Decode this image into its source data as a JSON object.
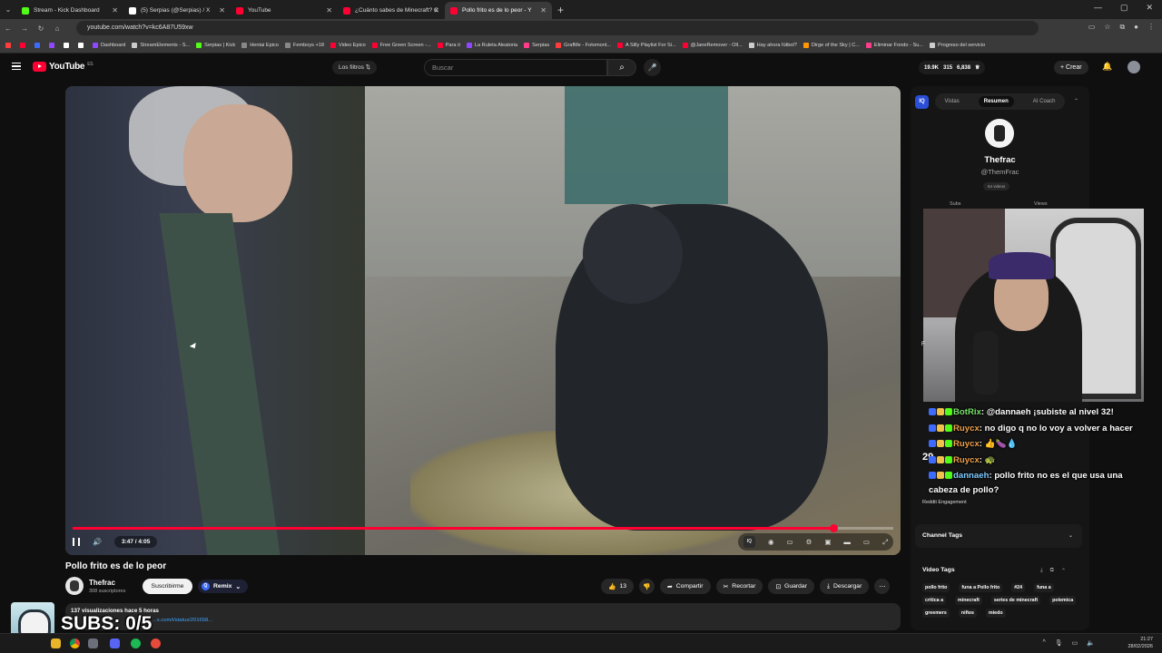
{
  "browser": {
    "tabs": [
      {
        "title": "Stream - Kick Dashboard",
        "color": "#53fc18",
        "active": false
      },
      {
        "title": "(5) Serpias (@Serpias) / X",
        "color": "#ffffff",
        "active": false
      },
      {
        "title": "YouTube",
        "color": "#ff0033",
        "active": false
      },
      {
        "title": "¿Cuánto sabes de Minecraft? C",
        "color": "#ff0033",
        "active": false
      },
      {
        "title": "Pollo frito es de lo peor - Y",
        "color": "#ff0033",
        "active": true
      }
    ],
    "url": "youtube.com/watch?v=kc6A87U59xw",
    "bookmarks": [
      {
        "label": "",
        "color": "#ff3d3d"
      },
      {
        "label": "",
        "color": "#ff0033"
      },
      {
        "label": "",
        "color": "#3d6bff"
      },
      {
        "label": "",
        "color": "#9146ff"
      },
      {
        "label": "",
        "color": "#ffffff"
      },
      {
        "label": "",
        "color": "#ffffff"
      },
      {
        "label": "Dashboard",
        "color": "#9146ff"
      },
      {
        "label": "StreamElements - S...",
        "color": "#cccccc"
      },
      {
        "label": "Serpias | Kick",
        "color": "#53fc18"
      },
      {
        "label": "Hentai Epico",
        "color": "#888888"
      },
      {
        "label": "Femboys +18",
        "color": "#888888"
      },
      {
        "label": "Video Epico",
        "color": "#ff0033"
      },
      {
        "label": "Free Green Screen -...",
        "color": "#ff0033"
      },
      {
        "label": "Para ti",
        "color": "#ff0033"
      },
      {
        "label": "La Ruleta Aleatoria",
        "color": "#9146ff"
      },
      {
        "label": "Serpias",
        "color": "#ff3d8b"
      },
      {
        "label": "GrafMe - Fotomont...",
        "color": "#ff3d3d"
      },
      {
        "label": "A Silly Playlist For Si...",
        "color": "#ff0033"
      },
      {
        "label": "@JaneRemover - Oll...",
        "color": "#ff0033"
      },
      {
        "label": "Hay ahora fútbol?",
        "color": "#cccccc"
      },
      {
        "label": "Dirge of the Sky | C...",
        "color": "#ff9800"
      },
      {
        "label": "Eliminar Fondo - Su...",
        "color": "#ff3d8b"
      },
      {
        "label": "Progreso del servicio",
        "color": "#cccccc"
      }
    ]
  },
  "youtube": {
    "logo_text": "YouTube",
    "logo_region": "ES",
    "filters_label": "Los filtros",
    "search_placeholder": "Buscar",
    "stats": {
      "views": "19.9K",
      "likes": "315",
      "subs": "6,838"
    },
    "create_label": "Crear",
    "accent_color": "#ff0033"
  },
  "video": {
    "title": "Pollo frito es de lo peor",
    "current_time": "3:47",
    "duration": "4:05",
    "progress_fraction": 0.927,
    "channel_name": "Thefrac",
    "channel_subs": "308 suscriptores",
    "subscribe_label": "Suscribirme",
    "remix_label": "Remix",
    "likes": "13",
    "share_label": "Compartir",
    "clip_label": "Recortar",
    "save_label": "Guardar",
    "download_label": "Descargar",
    "views_meta": "137 visualizaciones  hace 5 horas",
    "desc_link": "...x.com/i/status/201658..."
  },
  "sidebar": {
    "tabs": [
      "Vistas",
      "Resumen",
      "AI Coach"
    ],
    "active_tab": "Resumen",
    "channel_name": "Thefrac",
    "channel_handle": "@ThemFrac",
    "videos_label": "64 videos",
    "subs_label": "Subs",
    "views_label": "Views",
    "channel_tags_label": "Channel Tags",
    "video_tags_label": "Video Tags",
    "tags": [
      "pollo frito",
      "funa a Pollo frito",
      "#24",
      "funa a",
      "critica a",
      "minecraft",
      "series de minecraft",
      "polemica",
      "greemers",
      "niños",
      "miedo"
    ]
  },
  "chat": {
    "messages": [
      {
        "user": "BotRix",
        "text": ": @dannaeh ¡subiste al nivel 32!",
        "color": "#79e36a"
      },
      {
        "user": "Ruycx",
        "text": ": no digo q no lo voy a volver a hacer",
        "color": "#f0a04b"
      },
      {
        "user": "Ruycx",
        "text": ": 👍🍆💧",
        "color": "#f0a04b"
      },
      {
        "user": "Ruycx",
        "text": ": 🐢",
        "color": "#f0a04b"
      },
      {
        "user": "dannaeh",
        "text": ": pollo frito no es el que usa una cabeza de pollo?",
        "color": "#7ecbff"
      }
    ],
    "side_number": "29",
    "small_label": "Reddit Engagement"
  },
  "overlay": {
    "subs_text": "SUBS: 0/5"
  },
  "taskbar": {
    "time": "21:27",
    "date": "28/02/2026"
  }
}
